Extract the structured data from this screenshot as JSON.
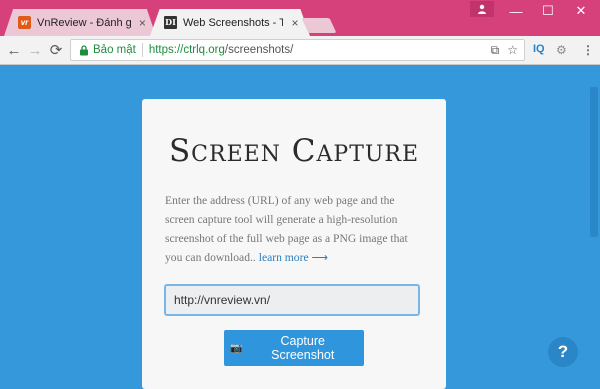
{
  "browser": {
    "tabs": [
      {
        "title": "VnReview - Đánh giá, tin",
        "favicon": "vnreview-favicon",
        "favicon_text": "vr"
      },
      {
        "title": "Web Screenshots - Take W",
        "favicon": "ctrlq-favicon",
        "favicon_text": "DI"
      }
    ],
    "close_glyph": "×",
    "window": {
      "minimize": "—",
      "maximize": "☐",
      "close": "✕"
    },
    "toolbar": {
      "back": "←",
      "forward": "→",
      "reload": "⟳",
      "security_label": "Bảo mật",
      "url_scheme_host": "https://ctrlq.org",
      "url_path": "/screenshots/",
      "translate_icon": "⧉",
      "star_icon": "☆",
      "ext1_label": "IQ",
      "ext2_icon": "⚙"
    }
  },
  "page": {
    "heading": "Screen Capture",
    "description": "Enter the address (URL) of any web page and the screen capture tool will generate a high-resolution screenshot of the full web page as a PNG image that you can download..",
    "learn_more": "learn more ⟶",
    "input_value": "http://vnreview.vn/",
    "button_icon": "📷",
    "button_label": "Capture Screenshot",
    "help_label": "?"
  },
  "colors": {
    "titlebar": "#d6407b",
    "page_background": "#3598db",
    "button": "#2f95dc",
    "secure_green": "#1e8e3e"
  }
}
